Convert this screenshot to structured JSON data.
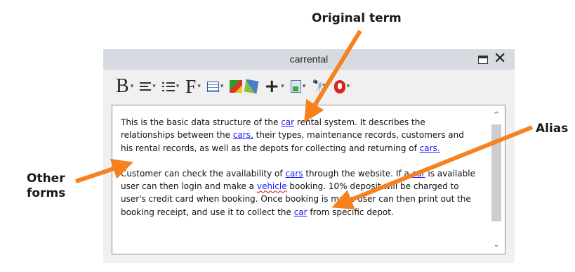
{
  "callouts": {
    "original_term": "Original term",
    "alias": "Alias",
    "other_forms_1": "Other",
    "other_forms_2": "forms"
  },
  "window": {
    "title": "carrental",
    "maximize_icon": "maximize-icon",
    "close_glyph": "✕"
  },
  "toolbar": {
    "bold_glyph": "B",
    "font_glyph": "F",
    "plus_glyph": "+",
    "find_glyph": "🔭",
    "dropdown_glyph": "▾",
    "icons": [
      "bold-icon",
      "align-icon",
      "list-icon",
      "font-icon",
      "table-icon",
      "image-icon",
      "pen-icon",
      "plus-icon",
      "document-icon",
      "find-icon",
      "microphone-icon"
    ]
  },
  "editor": {
    "p1": {
      "t1": "This is the basic data structure of the ",
      "car1": "car",
      "t2": " rental system. It describes the relationships between the ",
      "cars1": "cars,",
      "t3": " their types, maintenance records, customers and his rental records, as well as the depots for collecting and returning of ",
      "cars2": "cars."
    },
    "p2": {
      "t1": "Customer can check the availability of ",
      "cars3": "cars",
      "t2": " through the website. If a ",
      "car2": "car",
      "t3": " is available user can then login and make a ",
      "vehicle": "vehicle",
      "t4": " booking. 10% deposit will be charged to user's credit card when booking. Once booking is made user can then print out the booking receipt, and use it to collect the ",
      "car3": "car",
      "t5": " from specific depot."
    },
    "scroll_up": "^",
    "scroll_down": "⌄"
  },
  "colors": {
    "arrow": "#f5821f",
    "term_link": "#1a1aff",
    "titlebar": "#d5dbe1"
  }
}
